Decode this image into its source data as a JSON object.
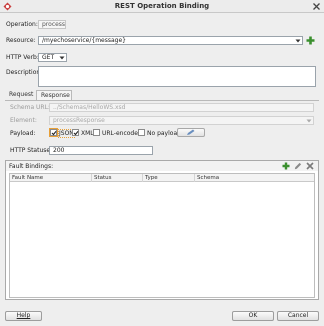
{
  "window": {
    "title": "REST Operation Binding"
  },
  "operation": {
    "label": "Operation:",
    "value": "process"
  },
  "resource": {
    "label": "Resource:",
    "value": "/myechoservice/{message}"
  },
  "http_verb": {
    "label": "HTTP Verb:",
    "value": "GET"
  },
  "description": {
    "label": "Description:",
    "value": ""
  },
  "tabs": [
    {
      "label": "Request"
    },
    {
      "label": "Response"
    }
  ],
  "response": {
    "schema_url": {
      "label": "Schema URL:",
      "value": "../Schemas/HelloWS.xsd"
    },
    "element": {
      "label": "Element:",
      "value": "processResponse"
    },
    "payload": {
      "label": "Payload:",
      "options": [
        {
          "label": "JSON",
          "checked": true
        },
        {
          "label": "XML",
          "checked": false
        },
        {
          "label": "URL-encoded",
          "checked": false
        },
        {
          "label": "No payload",
          "checked": false
        }
      ]
    },
    "http_statuses": {
      "label": "HTTP Statuses:",
      "value": "200"
    }
  },
  "fault_bindings": {
    "title": "Fault Bindings:",
    "columns": [
      "Fault Name",
      "Status",
      "Type",
      "Schema"
    ]
  },
  "buttons": {
    "help": "Help",
    "ok": "OK",
    "cancel": "Cancel"
  },
  "colors": {
    "add_green": "#3a8f2e",
    "close_red": "#c94040",
    "focus_orange": "#e8a038"
  }
}
